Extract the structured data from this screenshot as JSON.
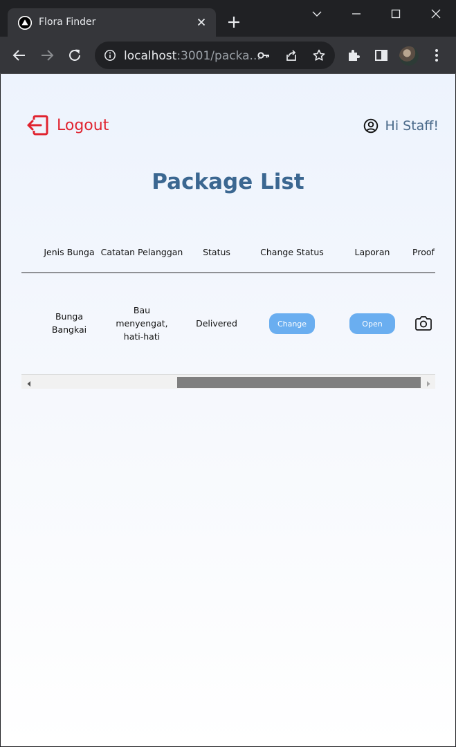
{
  "browser": {
    "tab_title": "Flora Finder",
    "url_host": "localhost",
    "url_rest": ":3001/packa..."
  },
  "header": {
    "logout_label": "Logout",
    "greeting": "Hi Staff!"
  },
  "page_title": "Package List",
  "table": {
    "columns": [
      "Jenis Bunga",
      "Catatan Pelanggan",
      "Status",
      "Change Status",
      "Laporan",
      "Proof"
    ],
    "rows": [
      {
        "jenis_bunga": [
          "Bunga",
          "Bangkai"
        ],
        "catatan": [
          "Bau",
          "menyengat,",
          "hati-hati"
        ],
        "status": "Delivered",
        "change_label": "Change",
        "laporan_label": "Open"
      }
    ]
  },
  "colors": {
    "accent": "#3b6791",
    "logout": "#e0232f",
    "button": "#6aaef0"
  },
  "icons": [
    "logout-icon",
    "user-circle-icon",
    "camera-icon"
  ]
}
